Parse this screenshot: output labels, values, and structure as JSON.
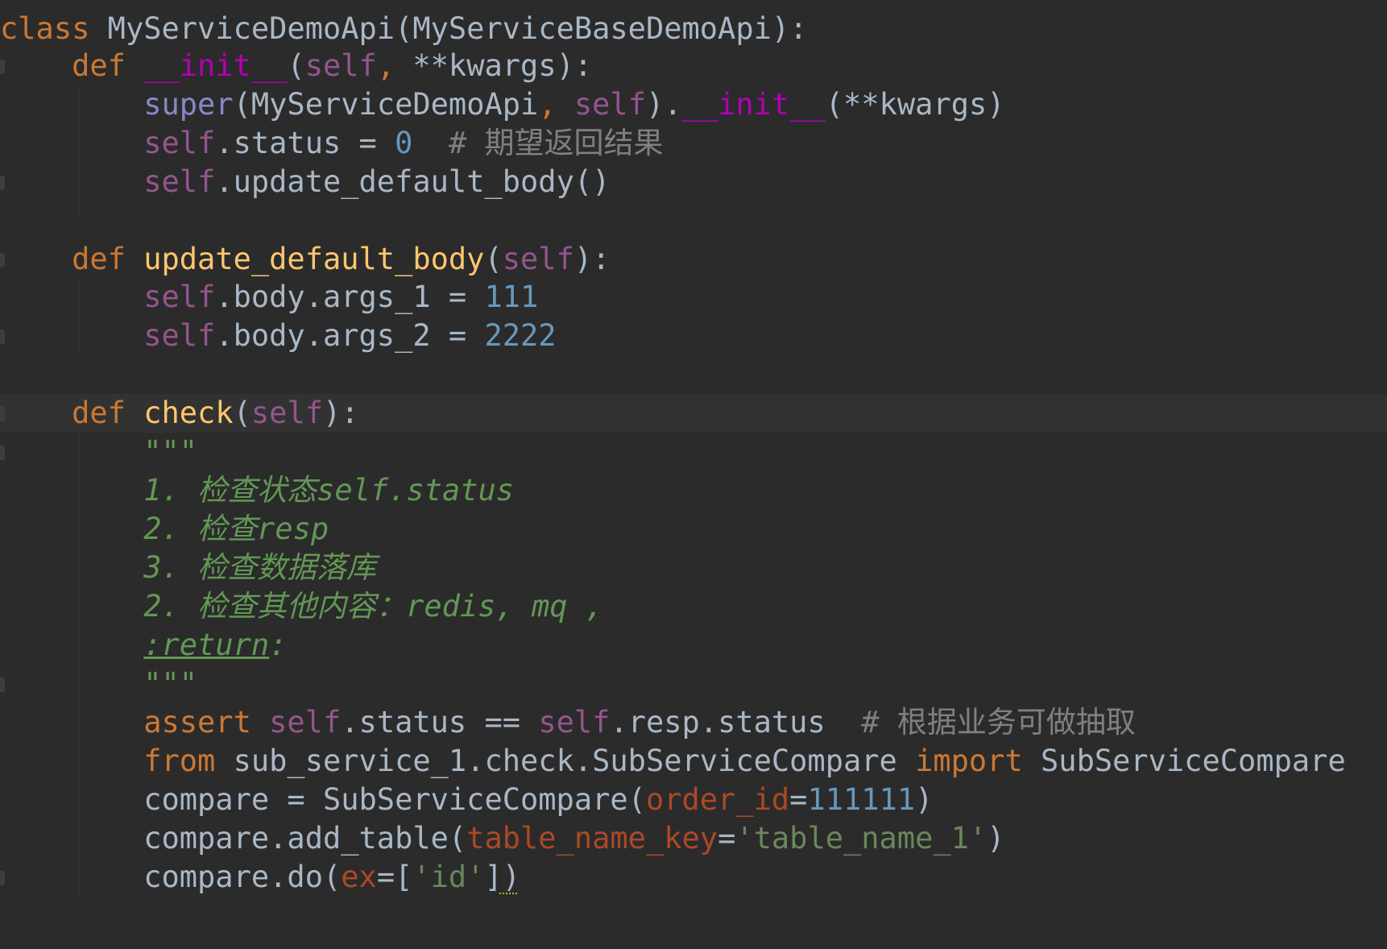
{
  "editor": {
    "colors": {
      "background": "#2b2b2b",
      "current_line": "#323232",
      "keyword": "#cc7832",
      "dunder": "#b200b2",
      "self": "#94558d",
      "builtin": "#8888c6",
      "number": "#6897bb",
      "comment": "#808080",
      "docstring": "#629755",
      "function_name": "#ffc66d",
      "parameter": "#aa4926",
      "string": "#6a8759",
      "plain": "#a9b7c6"
    },
    "lines": [
      {
        "tokens": [
          [
            "kw",
            "class"
          ],
          [
            "plain",
            " MyServiceDemoApi(MyServiceBaseDemoApi):"
          ]
        ]
      },
      {
        "tokens": [
          [
            "plain",
            "    "
          ],
          [
            "kw",
            "def"
          ],
          [
            "plain",
            " "
          ],
          [
            "dunder",
            "__init__"
          ],
          [
            "plain",
            "("
          ],
          [
            "selfk",
            "self"
          ],
          [
            "kw",
            ","
          ],
          [
            "plain",
            " **kwargs):"
          ]
        ]
      },
      {
        "tokens": [
          [
            "plain",
            "        "
          ],
          [
            "builtin",
            "super"
          ],
          [
            "plain",
            "(MyServiceDemoApi"
          ],
          [
            "kw",
            ","
          ],
          [
            "plain",
            " "
          ],
          [
            "selfk",
            "self"
          ],
          [
            "plain",
            ")."
          ],
          [
            "dunder",
            "__init__"
          ],
          [
            "plain",
            "(**kwargs)"
          ]
        ]
      },
      {
        "tokens": [
          [
            "plain",
            "        "
          ],
          [
            "selfk",
            "self"
          ],
          [
            "plain",
            ".status = "
          ],
          [
            "num",
            "0"
          ],
          [
            "plain",
            "  "
          ],
          [
            "cmt",
            "# 期望返回结果"
          ]
        ]
      },
      {
        "tokens": [
          [
            "plain",
            "        "
          ],
          [
            "selfk",
            "self"
          ],
          [
            "plain",
            ".update_default_body()"
          ]
        ]
      },
      {
        "tokens": []
      },
      {
        "tokens": [
          [
            "plain",
            "    "
          ],
          [
            "kw",
            "def"
          ],
          [
            "plain",
            " "
          ],
          [
            "fn",
            "update_default_body"
          ],
          [
            "plain",
            "("
          ],
          [
            "selfk",
            "self"
          ],
          [
            "plain",
            "):"
          ]
        ]
      },
      {
        "tokens": [
          [
            "plain",
            "        "
          ],
          [
            "selfk",
            "self"
          ],
          [
            "plain",
            ".body.args_1 = "
          ],
          [
            "num",
            "111"
          ]
        ]
      },
      {
        "tokens": [
          [
            "plain",
            "        "
          ],
          [
            "selfk",
            "self"
          ],
          [
            "plain",
            ".body.args_2 = "
          ],
          [
            "num",
            "2222"
          ]
        ]
      },
      {
        "tokens": []
      },
      {
        "tokens": [
          [
            "plain",
            "    "
          ],
          [
            "kw",
            "def"
          ],
          [
            "plain",
            " "
          ],
          [
            "fn",
            "check"
          ],
          [
            "plain",
            "("
          ],
          [
            "selfk",
            "self"
          ],
          [
            "plain",
            "):"
          ]
        ]
      },
      {
        "tokens": [
          [
            "plain",
            "        "
          ],
          [
            "doc",
            "\"\"\""
          ]
        ]
      },
      {
        "tokens": [
          [
            "plain",
            "        "
          ],
          [
            "doc",
            "1. 检查状态self.status"
          ]
        ]
      },
      {
        "tokens": [
          [
            "plain",
            "        "
          ],
          [
            "doc",
            "2. 检查resp"
          ]
        ]
      },
      {
        "tokens": [
          [
            "plain",
            "        "
          ],
          [
            "doc",
            "3. 检查数据落库"
          ]
        ]
      },
      {
        "tokens": [
          [
            "plain",
            "        "
          ],
          [
            "doc",
            "2. 检查其他内容：redis, mq ,"
          ]
        ]
      },
      {
        "tokens": [
          [
            "plain",
            "        "
          ],
          [
            "doc-tag",
            ":return"
          ],
          [
            "doc",
            ":"
          ]
        ]
      },
      {
        "tokens": [
          [
            "plain",
            "        "
          ],
          [
            "doc",
            "\"\"\""
          ]
        ]
      },
      {
        "tokens": [
          [
            "plain",
            "        "
          ],
          [
            "kw",
            "assert"
          ],
          [
            "plain",
            " "
          ],
          [
            "selfk",
            "self"
          ],
          [
            "plain",
            ".status == "
          ],
          [
            "selfk",
            "self"
          ],
          [
            "plain",
            ".resp.status  "
          ],
          [
            "cmt",
            "# 根据业务可做抽取"
          ]
        ]
      },
      {
        "tokens": [
          [
            "plain",
            "        "
          ],
          [
            "kw",
            "from"
          ],
          [
            "plain",
            " sub_service_1.check.SubServiceCompare "
          ],
          [
            "kw",
            "import"
          ],
          [
            "plain",
            " SubServiceCompare"
          ]
        ]
      },
      {
        "tokens": [
          [
            "plain",
            "        compare = SubServiceCompare("
          ],
          [
            "param",
            "order_id"
          ],
          [
            "plain",
            "="
          ],
          [
            "num",
            "111111"
          ],
          [
            "plain",
            ")"
          ]
        ]
      },
      {
        "tokens": [
          [
            "plain",
            "        compare.add_table("
          ],
          [
            "param",
            "table_name_key"
          ],
          [
            "plain",
            "="
          ],
          [
            "str",
            "'table_name_1'"
          ],
          [
            "plain",
            ")"
          ]
        ]
      },
      {
        "tokens": [
          [
            "plain",
            "        compare.do("
          ],
          [
            "param",
            "ex"
          ],
          [
            "plain",
            "=["
          ],
          [
            "str",
            "'id'"
          ],
          [
            "plain",
            "])"
          ]
        ]
      }
    ]
  }
}
